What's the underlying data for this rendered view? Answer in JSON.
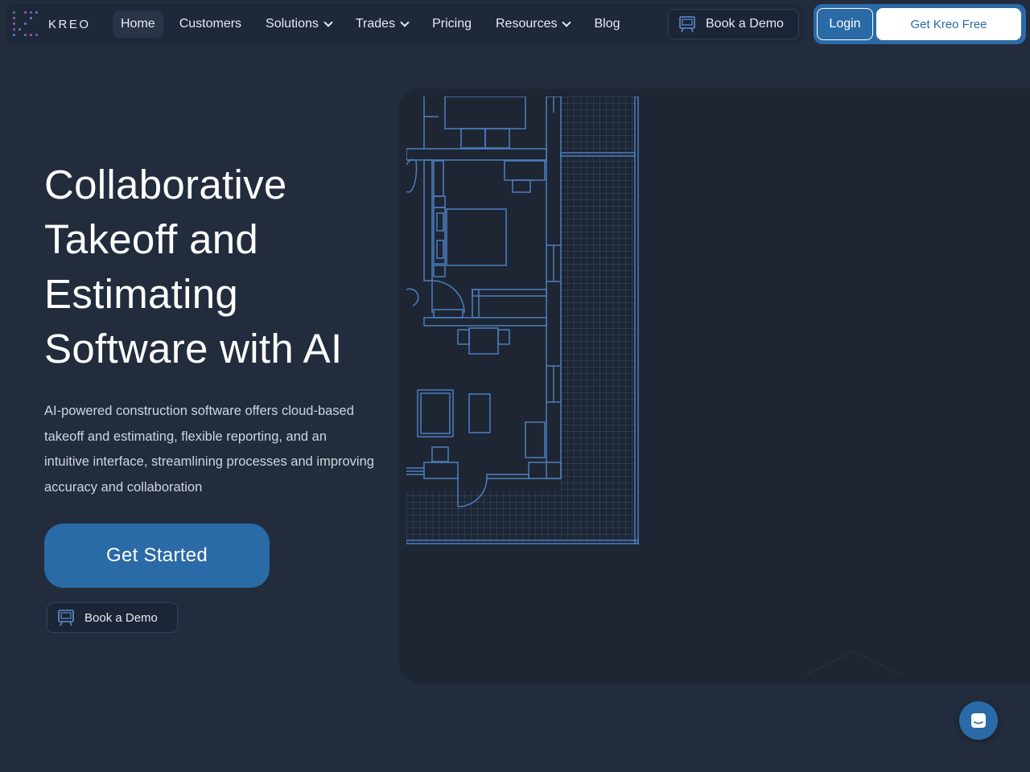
{
  "brand": {
    "name": "KREO",
    "logo_dot_colors": [
      "#6b7a90",
      "#8a6fb0",
      "#b24fc4",
      "#7c5bd0",
      "#5c82d6"
    ]
  },
  "nav": {
    "items": [
      {
        "label": "Home",
        "active": true,
        "dropdown": false
      },
      {
        "label": "Customers",
        "active": false,
        "dropdown": false
      },
      {
        "label": "Solutions",
        "active": false,
        "dropdown": true
      },
      {
        "label": "Trades",
        "active": false,
        "dropdown": true
      },
      {
        "label": "Pricing",
        "active": false,
        "dropdown": false
      },
      {
        "label": "Resources",
        "active": false,
        "dropdown": true
      },
      {
        "label": "Blog",
        "active": false,
        "dropdown": false
      }
    ],
    "demo_label": "Book a Demo",
    "login_label": "Login",
    "free_label": "Get Kreo Free"
  },
  "hero": {
    "title_lines": [
      "Collaborative",
      "Takeoff and",
      "Estimating",
      "Software with AI"
    ],
    "description": "AI-powered construction software offers cloud-based takeoff and estimating, flexible reporting, and an intuitive interface, streamlining processes and improving accuracy and collaboration",
    "cta_label": "Get Started",
    "demo_label": "Book a Demo"
  },
  "colors": {
    "background": "#222c3c",
    "accent": "#2a6aa6",
    "panel": "#1e2633",
    "plan_line": "#4d7fc0"
  },
  "icons": {
    "demo": "presentation-board-icon",
    "chat": "chat-bubble-icon",
    "chevron": "chevron-down-icon"
  }
}
